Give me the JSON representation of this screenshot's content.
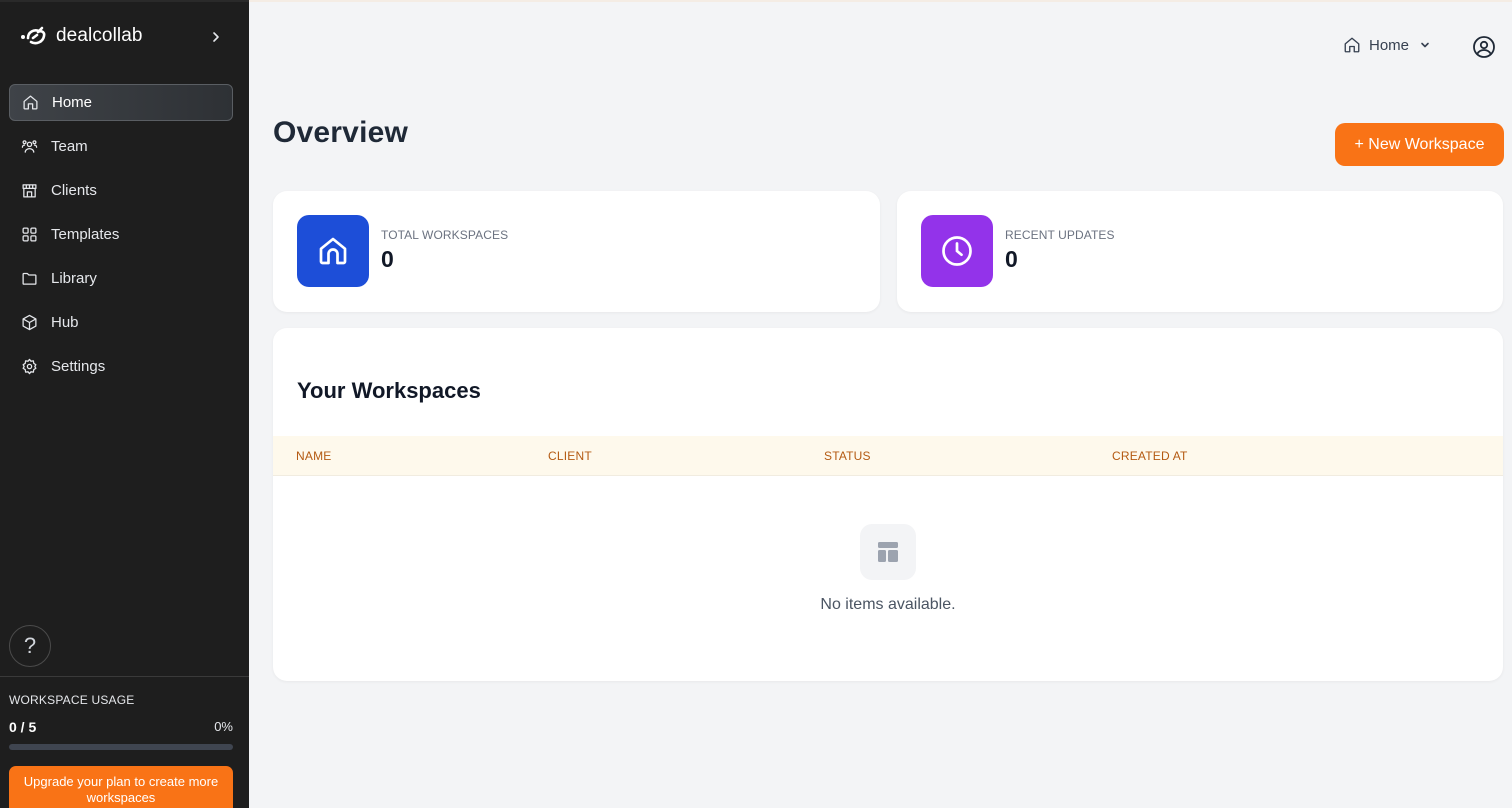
{
  "brand": {
    "name": "dealcollab"
  },
  "sidebar": {
    "items": [
      {
        "label": "Home",
        "icon": "home-icon",
        "active": true
      },
      {
        "label": "Team",
        "icon": "team-icon"
      },
      {
        "label": "Clients",
        "icon": "store-icon"
      },
      {
        "label": "Templates",
        "icon": "grid-icon"
      },
      {
        "label": "Library",
        "icon": "folder-icon"
      },
      {
        "label": "Hub",
        "icon": "cube-icon"
      },
      {
        "label": "Settings",
        "icon": "gear-icon"
      }
    ],
    "help_label": "?",
    "usage": {
      "title": "WORKSPACE USAGE",
      "count": "0 / 5",
      "percent": "0%",
      "fraction": 0
    },
    "upgrade_label": "Upgrade your plan to create more workspaces"
  },
  "header": {
    "home_label": "Home",
    "user_icon": "user-circle-icon"
  },
  "main": {
    "title": "Overview",
    "new_workspace_label": "+ New Workspace",
    "stats": [
      {
        "label": "TOTAL WORKSPACES",
        "value": "0",
        "color": "#1d4ed8",
        "icon": "home-icon"
      },
      {
        "label": "RECENT UPDATES",
        "value": "0",
        "color": "#9333ea",
        "icon": "clock-icon"
      }
    ],
    "workspaces": {
      "title": "Your Workspaces",
      "columns": [
        "NAME",
        "CLIENT",
        "STATUS",
        "CREATED AT"
      ],
      "empty_text": "No items available."
    }
  },
  "colors": {
    "accent": "#f97316",
    "sidebar_bg": "#1e1e1e",
    "blue": "#1d4ed8",
    "purple": "#9333ea"
  }
}
